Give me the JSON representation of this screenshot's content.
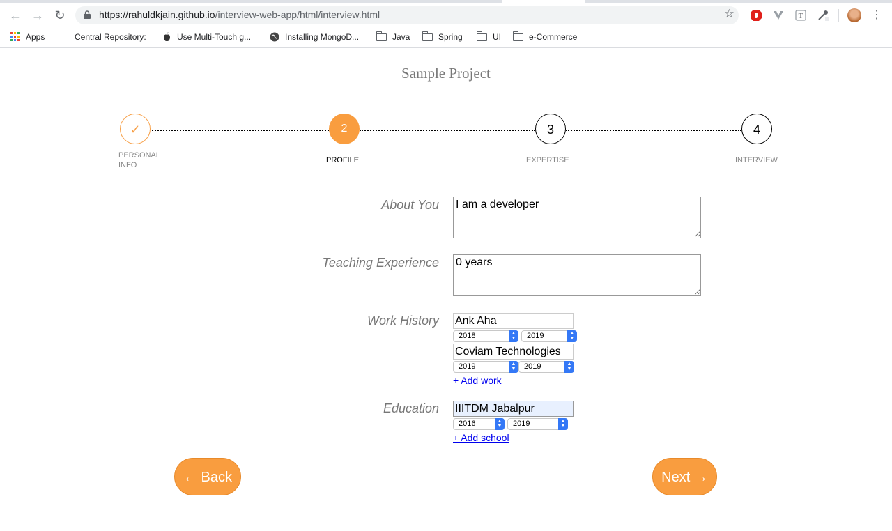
{
  "browser": {
    "url_host": "https://rahuldkjain.github.io",
    "url_path": "/interview-web-app/html/interview.html",
    "bookmarks": [
      {
        "label": "Apps",
        "icon": "apps-grid-icon"
      },
      {
        "label": "Central Repository:",
        "icon": ""
      },
      {
        "label": "Use Multi-Touch g...",
        "icon": "apple-icon"
      },
      {
        "label": "Installing MongoD...",
        "icon": "globe-icon"
      },
      {
        "label": "Java",
        "icon": "folder-icon"
      },
      {
        "label": "Spring",
        "icon": "folder-icon"
      },
      {
        "label": "UI",
        "icon": "folder-icon"
      },
      {
        "label": "e-Commerce",
        "icon": "folder-icon"
      }
    ]
  },
  "page": {
    "title": "Sample Project"
  },
  "stepper": {
    "steps": [
      {
        "number": "✓",
        "label": "PERSONAL INFO",
        "state": "done"
      },
      {
        "number": "2",
        "label": "PROFILE",
        "state": "active"
      },
      {
        "number": "3",
        "label": "EXPERTISE",
        "state": "todo"
      },
      {
        "number": "4",
        "label": "INTERVIEW",
        "state": "todo"
      }
    ]
  },
  "form": {
    "about": {
      "label": "About You",
      "value": "I am a developer"
    },
    "teaching": {
      "label": "Teaching Experience",
      "value": "0 years"
    },
    "work": {
      "label": "Work History",
      "entries": [
        {
          "company": "Ank Aha",
          "from": "2018",
          "to": "2019"
        },
        {
          "company": "Coviam Technologies",
          "from": "2019",
          "to": "2019"
        }
      ],
      "add_label": "+ Add work"
    },
    "education": {
      "label": "Education",
      "entries": [
        {
          "school": "IIITDM Jabalpur",
          "from": "2016",
          "to": "2019"
        }
      ],
      "add_label": "+ Add school"
    }
  },
  "buttons": {
    "back": "← Back",
    "next": "Next →"
  },
  "colors": {
    "accent": "#f99d3f",
    "link": "#0000ee"
  }
}
